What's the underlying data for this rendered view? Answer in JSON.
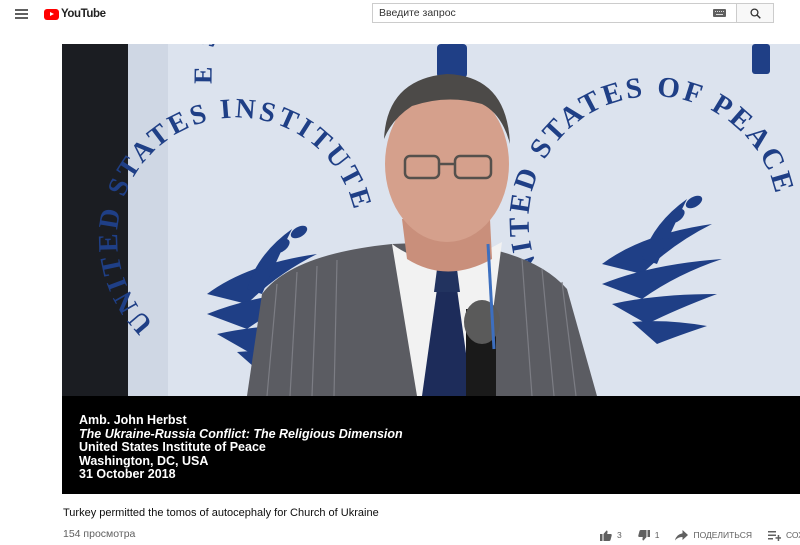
{
  "header": {
    "logo_text": "YouTube",
    "search_placeholder": "Введите запрос"
  },
  "video": {
    "overlay_lines": [
      "Amb. John Herbst",
      "The Ukraine-Russia Conflict: The Religious Dimension",
      "United States Institute of Peace",
      "Washington, DC, USA",
      "31 October 2018"
    ],
    "backdrop_text_left": "UNITED STATES INSTITUTE",
    "backdrop_text_right": "UNITED STATES OF PEACE"
  },
  "info": {
    "title": "Turkey permitted the tomos of autocephaly for Church of Ukraine",
    "views": "154 просмотра",
    "likes": "3",
    "dislikes": "1",
    "share_label": "ПОДЕЛИТЬСЯ",
    "save_label": "СОХР"
  },
  "colors": {
    "backdrop": "#dde4ef",
    "seal_blue": "#1f3f86",
    "brand_red": "#ff0000"
  }
}
